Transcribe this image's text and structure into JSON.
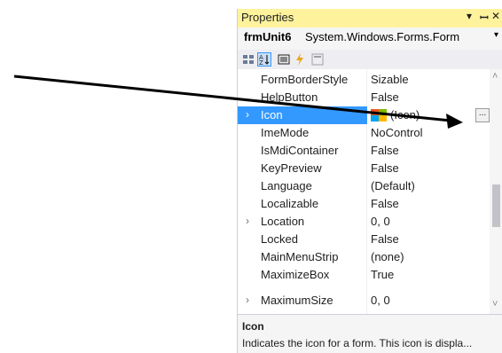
{
  "panel": {
    "title": "Properties",
    "controls": {
      "dropdown": "▾",
      "pin": "ᵖ",
      "close": "✕"
    }
  },
  "object_selector": {
    "name": "frmUnit6",
    "type": "System.Windows.Forms.Form",
    "dropdown": "▾"
  },
  "toolbar": {
    "categorized_icon": "categorized-icon",
    "alphabetical_icon": "alphabetical-icon",
    "properties_icon": "properties-icon",
    "events_icon": "events-icon",
    "property_pages_icon": "property-pages-icon"
  },
  "grid": {
    "rows": [
      {
        "name": "FormBorderStyle",
        "value": "Sizable",
        "expandable": false
      },
      {
        "name": "HelpButton",
        "value": "False",
        "expandable": false
      },
      {
        "name": "Icon",
        "value": "(Icon)",
        "expandable": true,
        "selected": true
      },
      {
        "name": "ImeMode",
        "value": "NoControl",
        "expandable": false
      },
      {
        "name": "IsMdiContainer",
        "value": "False",
        "expandable": false
      },
      {
        "name": "KeyPreview",
        "value": "False",
        "expandable": false
      },
      {
        "name": "Language",
        "value": "(Default)",
        "expandable": false
      },
      {
        "name": "Localizable",
        "value": "False",
        "expandable": false
      },
      {
        "name": "Location",
        "value": "0, 0",
        "expandable": true
      },
      {
        "name": "Locked",
        "value": "False",
        "expandable": false
      },
      {
        "name": "MainMenuStrip",
        "value": "(none)",
        "expandable": false
      },
      {
        "name": "MaximizeBox",
        "value": "True",
        "expandable": false
      },
      {
        "name": "MaximumSize",
        "value": "0, 0",
        "expandable": true
      }
    ],
    "ellipsis_label": "...",
    "expander_glyph": "›"
  },
  "description": {
    "title": "Icon",
    "text": "Indicates the icon for a form. This icon is displa..."
  },
  "colors": {
    "title_bar": "#fff29d",
    "selection": "#3399ff",
    "annotation_arrow": "#000000"
  }
}
